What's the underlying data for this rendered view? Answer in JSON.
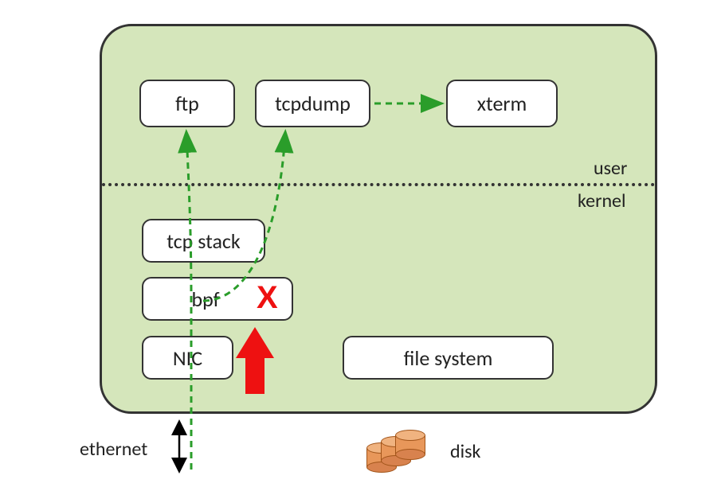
{
  "nodes": {
    "ftp": "ftp",
    "tcpdump": "tcpdump",
    "xterm": "xterm",
    "tcp_stack": "tcp stack",
    "bpf": "bpf",
    "nic": "NIC",
    "file_system": "file system"
  },
  "labels": {
    "user": "user",
    "kernel": "kernel",
    "ethernet": "ethernet",
    "disk": "disk"
  },
  "marks": {
    "filter_reject": "X"
  },
  "colors": {
    "box_bg": "#d5e6bb",
    "flow": "#2a9d2a",
    "reject": "#e11"
  }
}
